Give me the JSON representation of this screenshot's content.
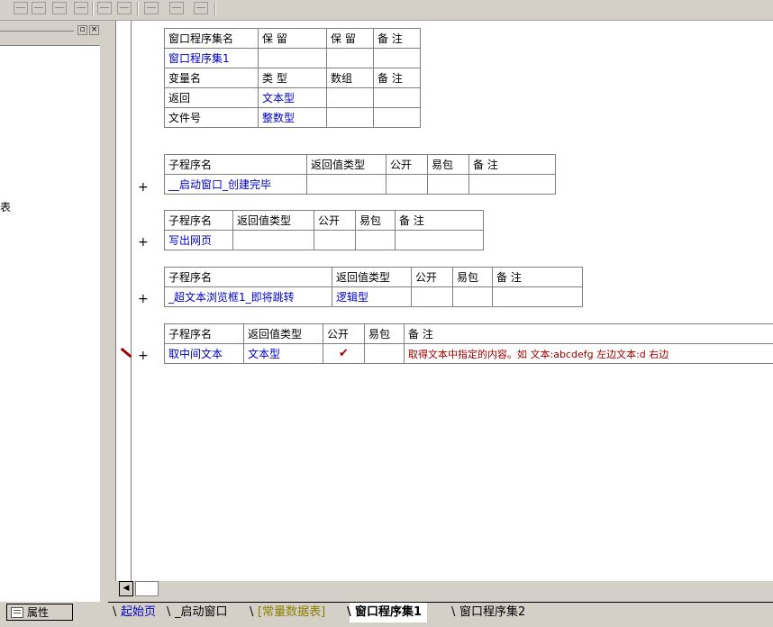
{
  "left_panel": {
    "clipped_text": "表",
    "prop_tab_label": "属性"
  },
  "program_set": {
    "headers": [
      "窗口程序集名",
      "保 留",
      "保 留",
      "备 注"
    ],
    "name": "窗口程序集1"
  },
  "variables": {
    "headers": [
      "变量名",
      "类 型",
      "数组",
      "备 注"
    ],
    "rows": [
      {
        "name": "返回",
        "type": "文本型"
      },
      {
        "name": "文件号",
        "type": "整数型"
      }
    ]
  },
  "subroutines": [
    {
      "headers": [
        "子程序名",
        "返回值类型",
        "公开",
        "易包",
        "备 注"
      ],
      "name": "__启动窗口_创建完毕",
      "return_type": "",
      "public": "",
      "note": ""
    },
    {
      "headers": [
        "子程序名",
        "返回值类型",
        "公开",
        "易包",
        "备 注"
      ],
      "name": "写出网页",
      "return_type": "",
      "public": "",
      "note": ""
    },
    {
      "headers": [
        "子程序名",
        "返回值类型",
        "公开",
        "易包",
        "备 注"
      ],
      "name": "_超文本浏览框1_即将跳转",
      "return_type": "逻辑型",
      "public": "",
      "note": ""
    },
    {
      "headers": [
        "子程序名",
        "返回值类型",
        "公开",
        "易包",
        "备 注"
      ],
      "name": "取中间文本",
      "return_type": "文本型",
      "public": "✔",
      "note": "取得文本中指定的内容。如 文本:abcdefg 左边文本:d 右边"
    }
  ],
  "plus_symbol": "+",
  "tabs": [
    "起始页",
    "_启动窗口",
    "[常量数据表]",
    "窗口程序集1",
    "窗口程序集2"
  ],
  "colors": {
    "blue_text": "#0000c8",
    "note_red": "#a00000",
    "olive_tab": "#8a8000"
  }
}
